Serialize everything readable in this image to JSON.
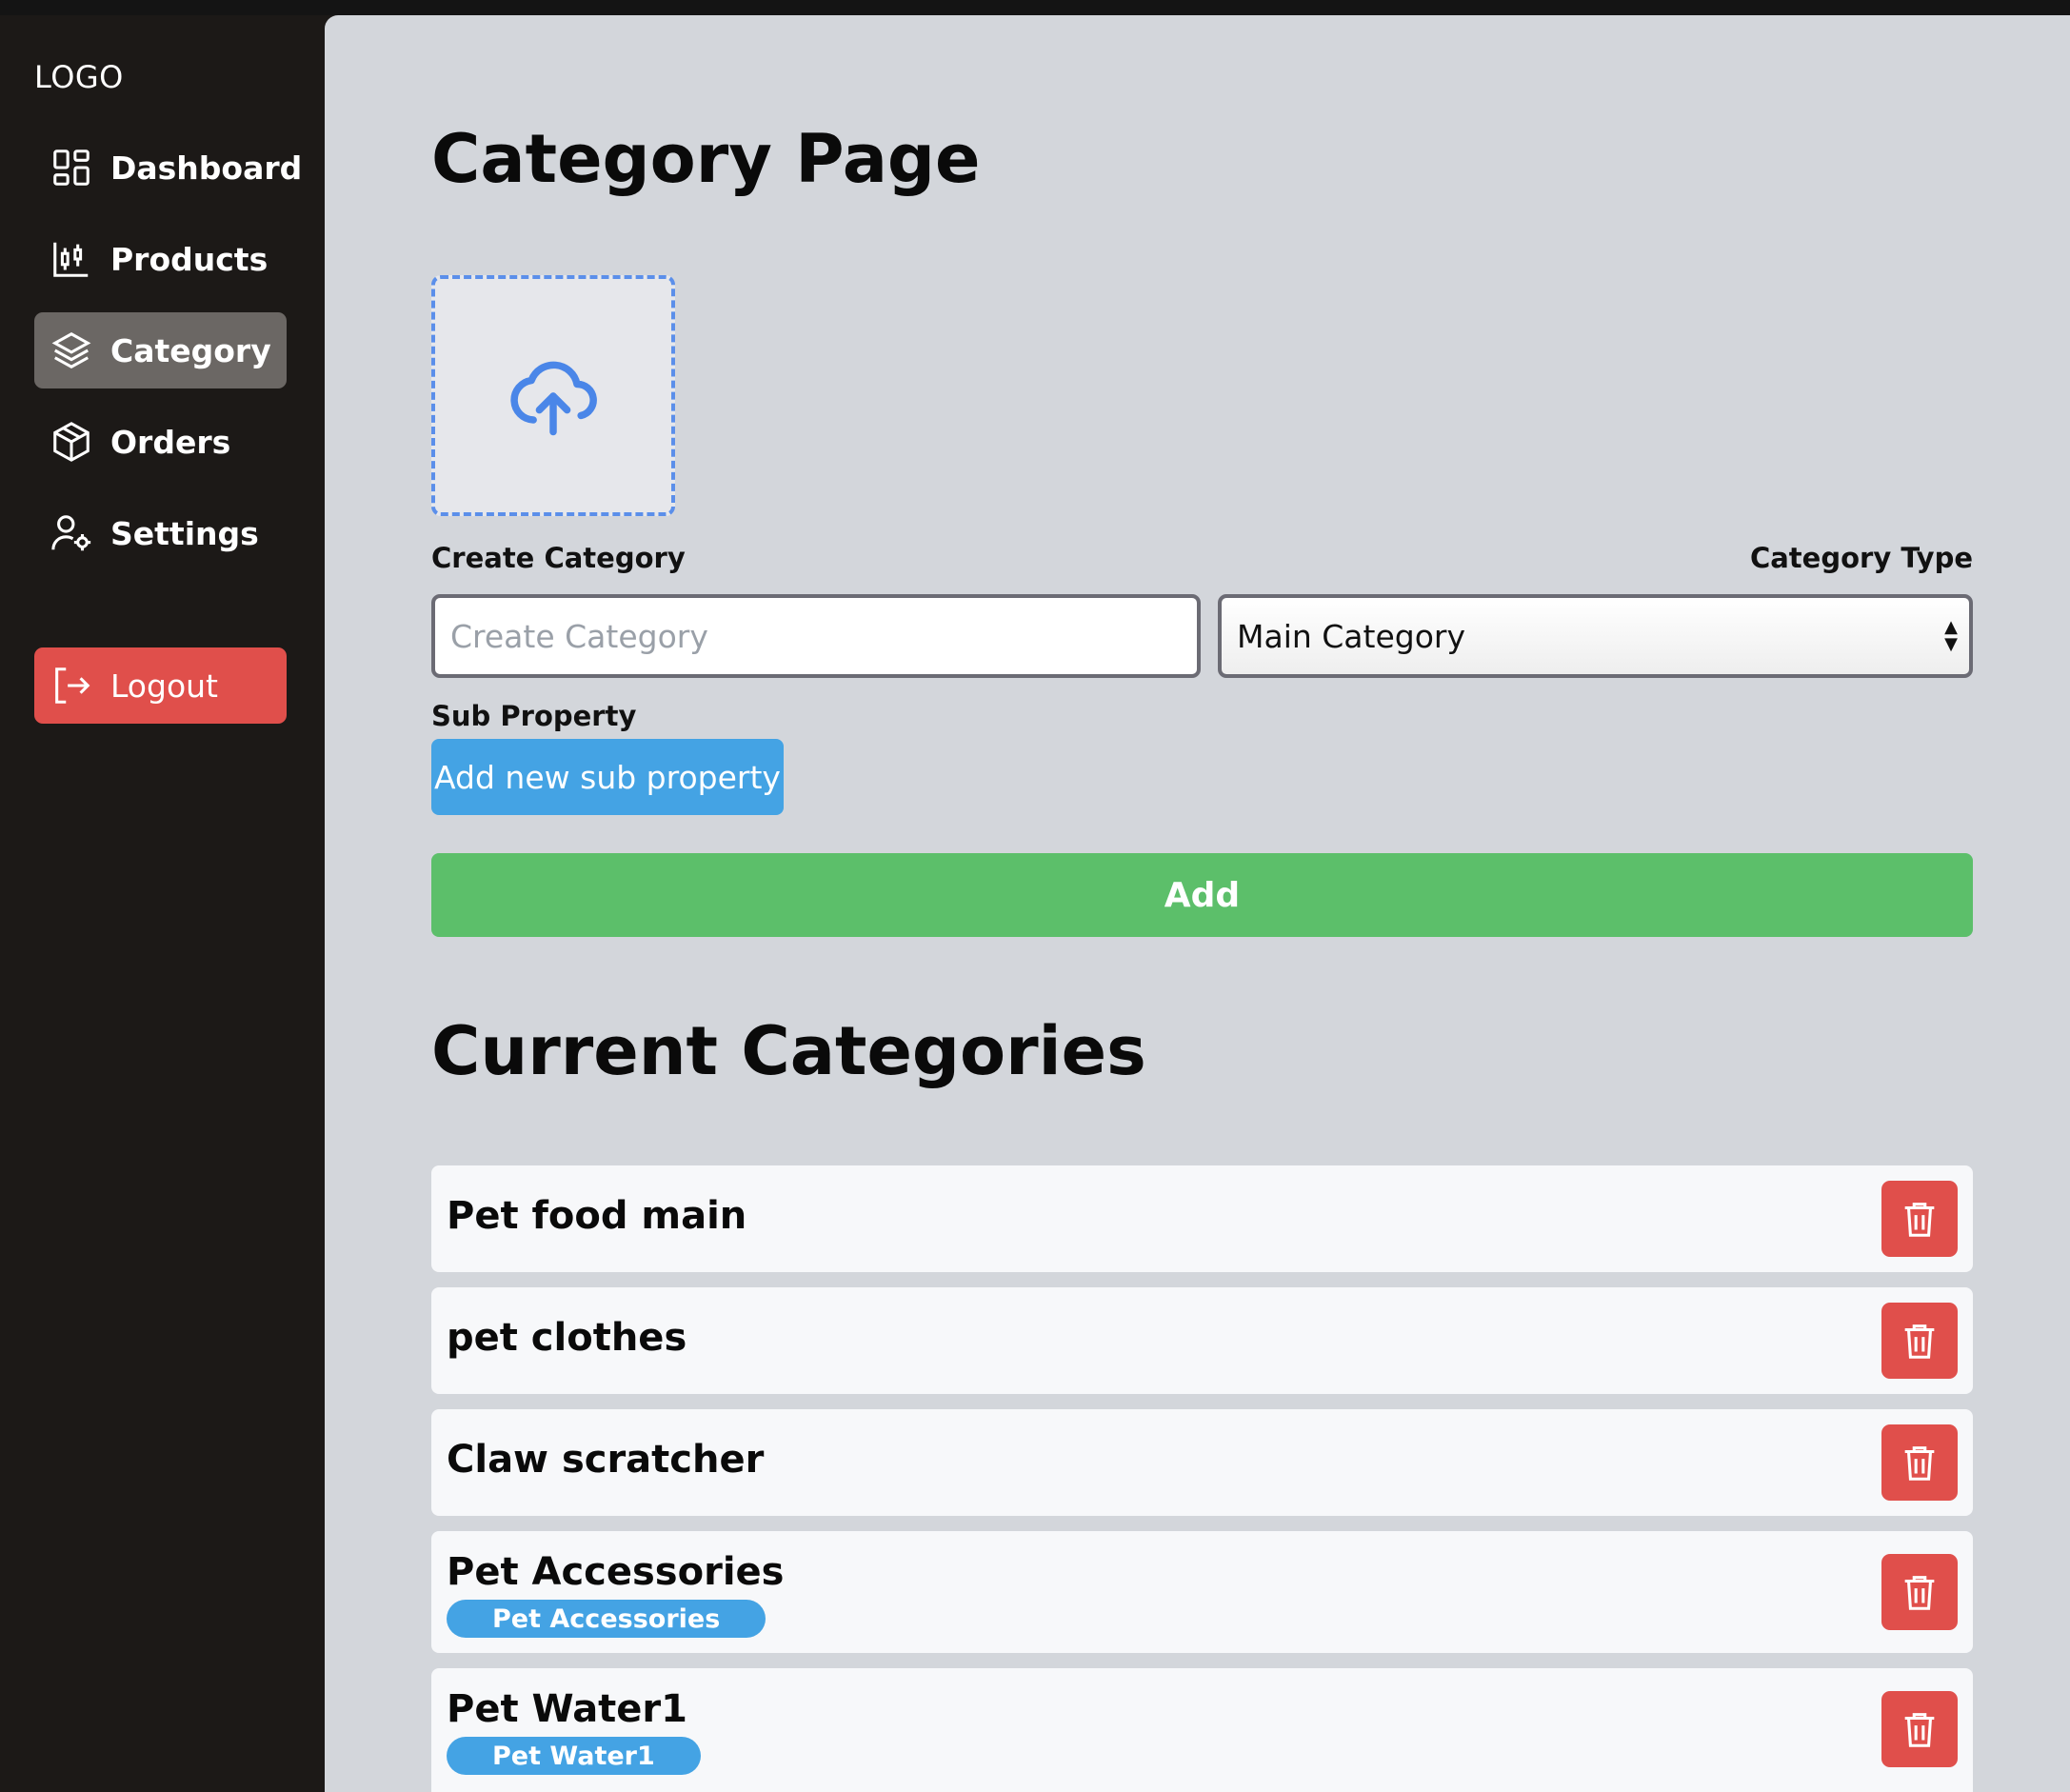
{
  "sidebar": {
    "logo": "LOGO",
    "items": [
      {
        "label": "Dashboard",
        "icon": "dashboard-icon"
      },
      {
        "label": "Products",
        "icon": "chart-icon"
      },
      {
        "label": "Category",
        "icon": "layers-icon",
        "active": true
      },
      {
        "label": "Orders",
        "icon": "box-icon"
      },
      {
        "label": "Settings",
        "icon": "user-settings-icon"
      }
    ],
    "logout_label": "Logout"
  },
  "main": {
    "title": "Category Page",
    "upload_icon": "cloud-upload-icon",
    "create_label": "Create Category",
    "create_placeholder": "Create Category",
    "create_value": "",
    "type_label": "Category Type",
    "type_selected": "Main Category",
    "sub_label": "Sub Property",
    "sub_button": "Add new sub property",
    "add_button": "Add",
    "current_title": "Current Categories",
    "categories": [
      {
        "name": "Pet food main",
        "tag": ""
      },
      {
        "name": "pet clothes",
        "tag": ""
      },
      {
        "name": "Claw scratcher",
        "tag": ""
      },
      {
        "name": "Pet Accessories",
        "tag": "Pet Accessories"
      },
      {
        "name": "Pet Water1",
        "tag": "Pet Water1"
      }
    ]
  },
  "colors": {
    "sidebar_bg": "#1c1917",
    "main_bg": "#d3d6db",
    "active_item": "#6b6764",
    "danger": "#e04f4b",
    "primary": "#44a3e4",
    "success": "#5cbf6a",
    "upload_accent": "#5b8fea"
  }
}
